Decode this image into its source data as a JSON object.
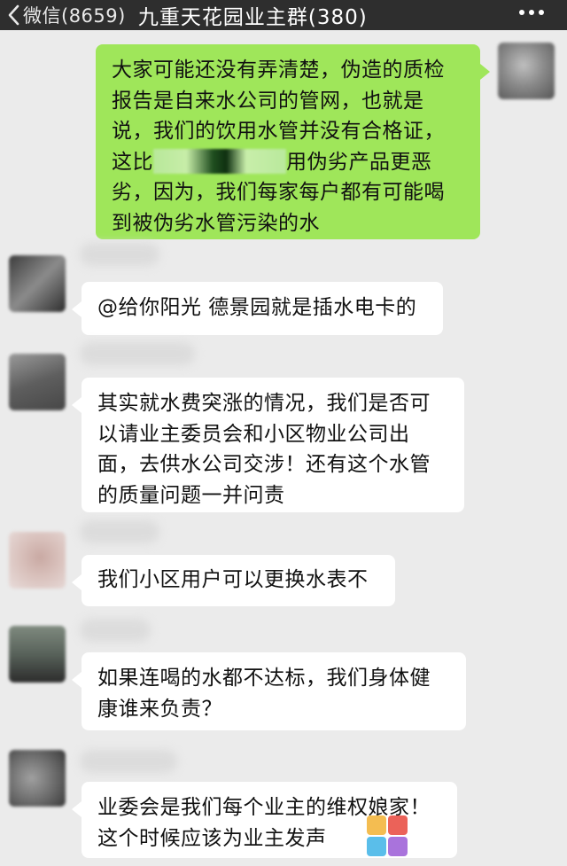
{
  "topbar": {
    "back_label": "微信(8659)",
    "title": "九重天花园业主群(380)"
  },
  "messages": [
    {
      "side": "right",
      "lines": [
        "大家可能还没有弄清楚，伪造的质检",
        "报告是自来水公司的管网，也就是",
        "说，我们的饮用水管并没有合格证，",
        "用伪劣产品更恶",
        "劣，因为，我们每家每户都有可能喝",
        "到被伪劣水管污染的水"
      ],
      "line4_prefix": "这比"
    },
    {
      "side": "left",
      "lines": [
        "@给你阳光 德景园就是插水电卡的"
      ]
    },
    {
      "side": "left",
      "lines": [
        "其实就水费突涨的情况，我们是否可",
        "以请业主委员会和小区物业公司出",
        "面，去供水公司交涉！还有这个水管",
        "的质量问题一并问责"
      ]
    },
    {
      "side": "left",
      "lines": [
        "我们小区用户可以更换水表不"
      ]
    },
    {
      "side": "left",
      "lines": [
        "如果连喝的水都不达标，我们身体健",
        "康谁来负责？"
      ]
    },
    {
      "side": "left",
      "lines": [
        "业委会是我们每个业主的维权娘家！",
        "这个时候应该为业主发声"
      ]
    }
  ],
  "colors": {
    "topbar": "#2e2e2e",
    "background": "#ebebeb",
    "bubble_self": "#9fe65a",
    "bubble_other": "#ffffff"
  },
  "icons": {
    "back": "chevron-left-icon",
    "more": "more-dots-icon"
  }
}
